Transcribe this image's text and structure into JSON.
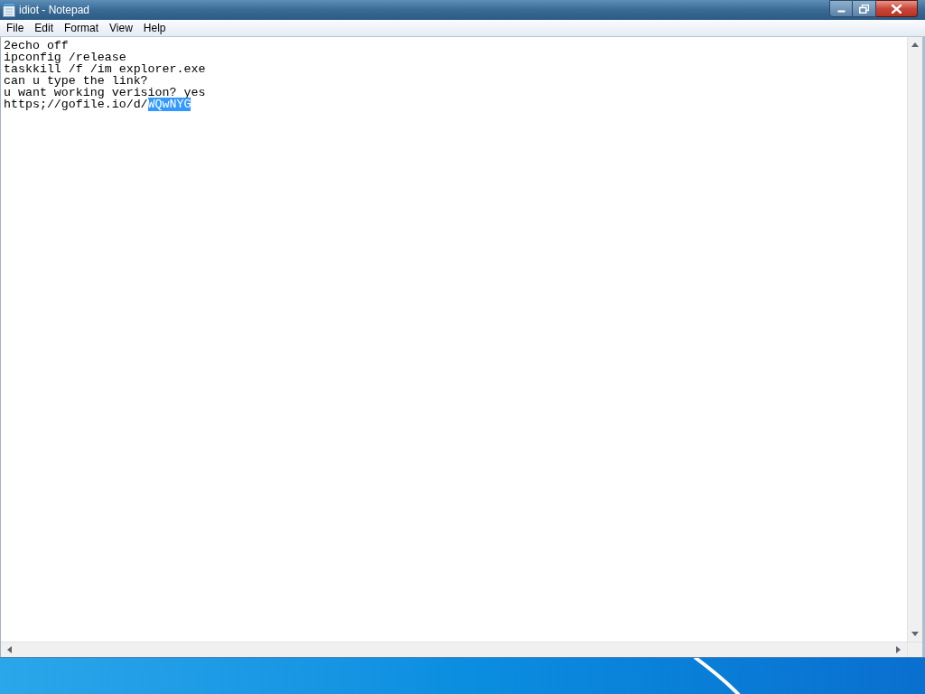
{
  "window": {
    "title": "idiot - Notepad"
  },
  "menu_bar": [
    "File",
    "Edit",
    "Format",
    "View",
    "Help"
  ],
  "document": {
    "lines": [
      {
        "segments": [
          {
            "text": "2echo off",
            "selected": false
          }
        ]
      },
      {
        "segments": [
          {
            "text": "ipconfig /release",
            "selected": false
          }
        ]
      },
      {
        "segments": [
          {
            "text": "taskkill /f /im explorer.exe",
            "selected": false
          }
        ]
      },
      {
        "segments": [
          {
            "text": "can u type the link?",
            "selected": false
          }
        ]
      },
      {
        "segments": [
          {
            "text": "u want working verision? yes",
            "selected": false
          }
        ]
      },
      {
        "segments": [
          {
            "text": "https;//gofile.io/d/",
            "selected": false
          },
          {
            "text": "WQwNYG",
            "selected": true
          }
        ]
      }
    ]
  }
}
